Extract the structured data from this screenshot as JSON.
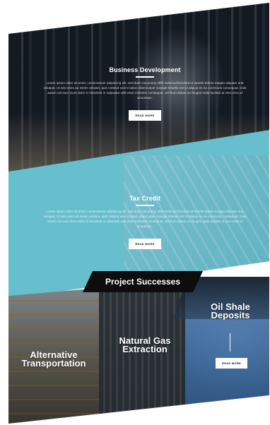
{
  "sections": {
    "business": {
      "title": "Business Development",
      "body": "Lorem ipsum dolor sit amet, consectetuer adipiscing elit, sed diam nonummy nibh euismod tincidunt ut laoreet dolore magna aliquam erat volutpat. Ut wisi enim ad minim veniam, quis nostrud exerci tation ullamcorper suscipit lobortis nisl ut aliquip ex ea commodo consequat. Duis autem vel eum iriure dolor in hendrerit in vulputate velit esse molestie consequat, vel illum dolore eu feugiat nulla facilisis at vero eros et accumsan.",
      "button": "READ MORE"
    },
    "tax_credit": {
      "title": "Tax Credit",
      "body": "Lorem ipsum dolor sit amet, consectetuer adipiscing elit, sed diam nonummy nibh euismod tincidunt ut laoreet dolore magna aliquam erat volutpat. Ut wisi enim ad minim veniam, quis nostrud exerci tation ullamcorper suscipit lobortis nisl ut aliquip ex ea commodo consequat. Duis autem vel eum iriure dolor in hendrerit in vulputate velit esse molestie consequat, vel illum dolore eu feugiat nulla facilisis at vero eros et accumsan.",
      "button": "READ MORE"
    },
    "project_successes": {
      "title": "Project Successes",
      "tiles": [
        {
          "title": "Alternative Transportation"
        },
        {
          "title": "Natural Gas Extraction"
        },
        {
          "title": "Oil Shale Deposits",
          "button": "READ MORE"
        }
      ]
    }
  },
  "colors": {
    "teal": "#67bfce",
    "banner": "#0d0d0d",
    "white": "#ffffff"
  }
}
